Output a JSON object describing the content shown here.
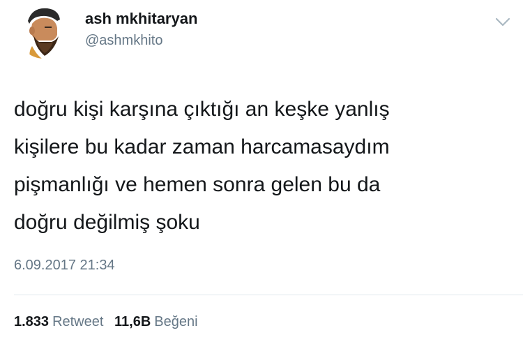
{
  "user": {
    "display_name": "ash mkhitaryan",
    "handle": "@ashmkhito",
    "avatar_icon": "bearded-man-avatar"
  },
  "tweet": {
    "lines": [
      "doğru kişi karşına çıktığı an keşke yanlış",
      "kişilere bu kadar zaman harcamasaydım",
      "pişmanlığı ve hemen sonra gelen bu da",
      "doğru değilmiş şoku"
    ],
    "timestamp": "6.09.2017 21:34"
  },
  "stats": {
    "retweets": {
      "count": "1.833",
      "label": "Retweet"
    },
    "likes": {
      "count": "11,6B",
      "label": "Beğeni"
    }
  },
  "menu": {
    "icon": "chevron-down-icon"
  },
  "colors": {
    "text_primary": "#14171a",
    "text_secondary": "#657786",
    "divider": "#e1e8ed",
    "caret": "#aab8c2"
  }
}
